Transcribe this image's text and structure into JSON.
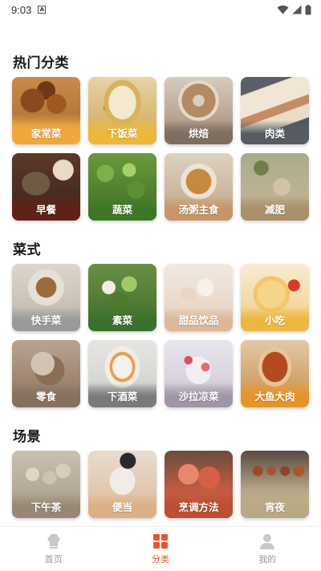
{
  "status": {
    "time": "9:03",
    "a_glyph": "A"
  },
  "sections": {
    "hot": {
      "title": "热门分类"
    },
    "dish": {
      "title": "菜式"
    },
    "scene": {
      "title": "场景"
    }
  },
  "hot_items": [
    {
      "label": "家常菜"
    },
    {
      "label": "下饭菜"
    },
    {
      "label": "烘焙"
    },
    {
      "label": "肉类"
    },
    {
      "label": "早餐"
    },
    {
      "label": "蔬菜"
    },
    {
      "label": "汤粥主食"
    },
    {
      "label": "减肥"
    }
  ],
  "dish_items": [
    {
      "label": "快手菜"
    },
    {
      "label": "素菜"
    },
    {
      "label": "甜品饮品"
    },
    {
      "label": "小吃"
    },
    {
      "label": "零食"
    },
    {
      "label": "下酒菜"
    },
    {
      "label": "沙拉凉菜"
    },
    {
      "label": "大鱼大肉"
    }
  ],
  "scene_items": [
    {
      "label": "下午茶"
    },
    {
      "label": "便当"
    },
    {
      "label": "烹调方法"
    },
    {
      "label": "宵夜"
    }
  ],
  "tabs": [
    {
      "label": "首页",
      "icon": "chef-hat-icon"
    },
    {
      "label": "分类",
      "icon": "grid-icon"
    },
    {
      "label": "我的",
      "icon": "person-icon"
    }
  ],
  "colors": {
    "accent": "#f0522f",
    "inactive": "#9a9a9a"
  }
}
